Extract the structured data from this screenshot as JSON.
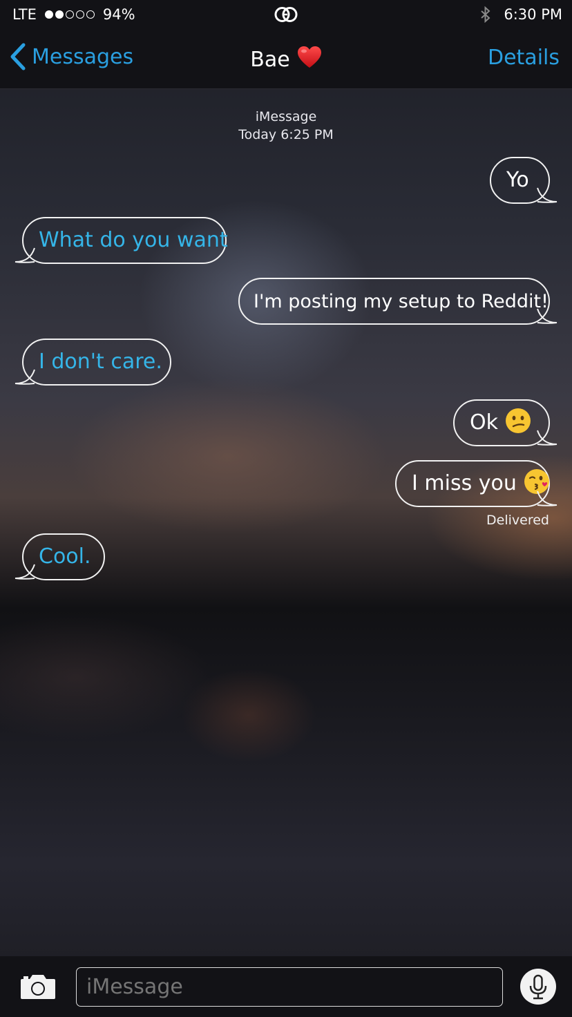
{
  "status_bar": {
    "carrier": "LTE",
    "signal_dots_filled": 2,
    "signal_dots_total": 5,
    "battery": "94%",
    "center_icon": "gucci-logo-icon",
    "bluetooth_icon": "bluetooth-icon",
    "time": "6:30 PM"
  },
  "nav": {
    "back_label": "Messages",
    "title": "Bae",
    "title_emoji": "heart-emoji-icon",
    "details_label": "Details",
    "accent_color": "#2a9fe0"
  },
  "conversation": {
    "service": "iMessage",
    "timestamp": "Today 6:25 PM",
    "messages": [
      {
        "from": "me",
        "text": "Yo"
      },
      {
        "from": "them",
        "text": "What do you want"
      },
      {
        "from": "me",
        "text": "I'm posting my setup to Reddit!"
      },
      {
        "from": "them",
        "text": "I don't care."
      },
      {
        "from": "me",
        "text": "Ok",
        "emoji": "confused-face-icon"
      },
      {
        "from": "me",
        "text": "I miss you",
        "emoji": "kissing-heart-face-icon"
      },
      {
        "from": "them",
        "text": "Cool."
      }
    ],
    "delivered_label": "Delivered",
    "received_color": "#35b5e8"
  },
  "input_bar": {
    "placeholder": "iMessage",
    "camera_icon": "camera-icon",
    "mic_icon": "microphone-icon"
  }
}
